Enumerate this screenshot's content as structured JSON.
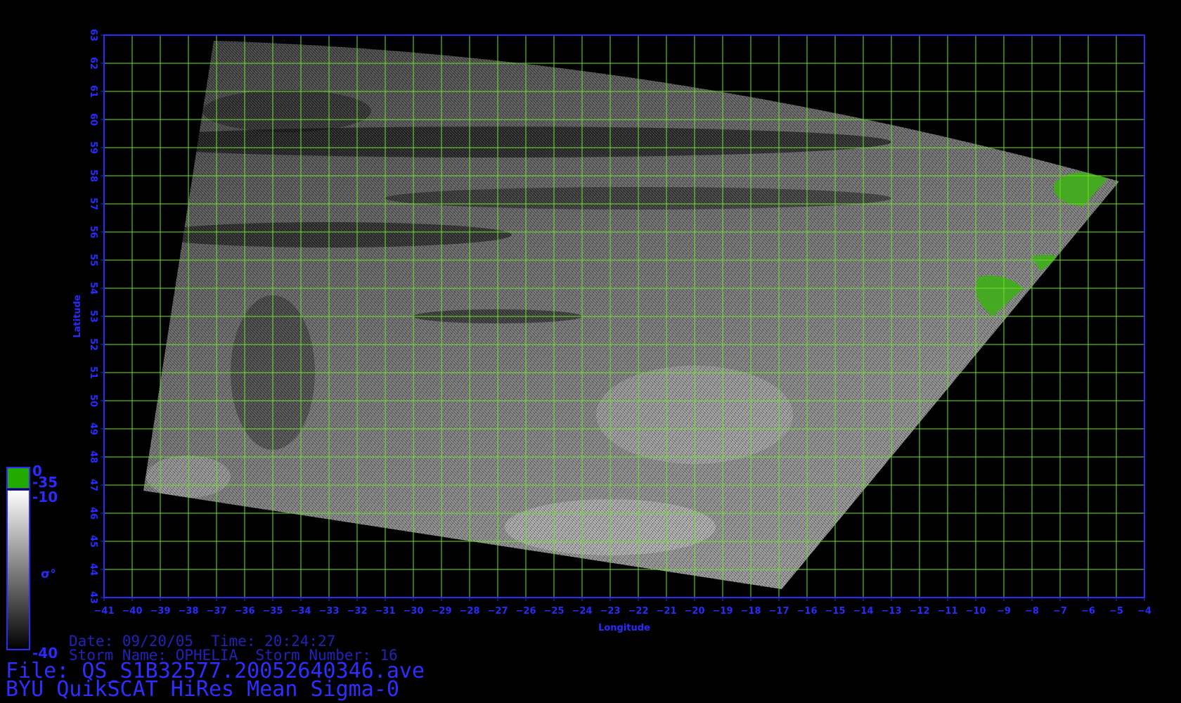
{
  "map": {
    "lon_range": [
      -41,
      -4
    ],
    "lat_range": [
      43,
      63
    ],
    "x_axis_label": "Longitude",
    "y_axis_label": "Latitude",
    "grid": true,
    "grid_color": "#6ee32a",
    "axis_color": "#2a2aff",
    "land_color": "#3fae18",
    "swath_corners_lonlat": [
      {
        "corner": "north-west",
        "lon": -37.1,
        "lat": 62.8
      },
      {
        "corner": "east-tip",
        "lon": -4.9,
        "lat": 57.8
      },
      {
        "corner": "south-east",
        "lon": -16.9,
        "lat": 43.3
      },
      {
        "corner": "west",
        "lon": -39.6,
        "lat": 46.8
      }
    ]
  },
  "colorbar": {
    "labels": {
      "zero": "0",
      "minus35": "-35",
      "minus10": "-10",
      "minus40": "-40"
    },
    "symbol": "σ°",
    "land_color": "#22aa00"
  },
  "info": {
    "date_time": "Date: 09/20/05  Time: 20:24:27",
    "storm": "Storm Name: OPHELIA  Storm Number: 16",
    "file": "File: QS_S1B32577.20052640346.ave",
    "product": "BYU QuikSCAT HiRes Mean Sigma-0"
  }
}
